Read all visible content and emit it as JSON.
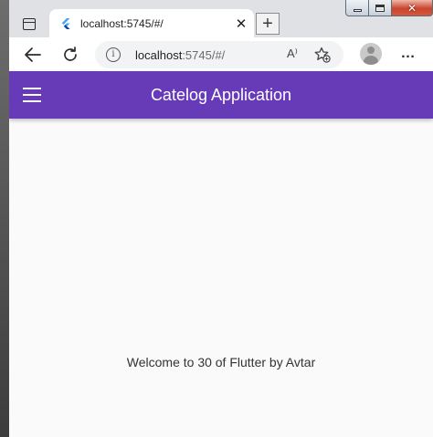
{
  "browser": {
    "tab": {
      "title": "localhost:5745/#/",
      "close_glyph": "✕"
    },
    "new_tab_glyph": "+",
    "caption": {
      "close_glyph": "✕"
    },
    "address_bar": {
      "host": "localhost",
      "rest": ":5745/#/",
      "info_glyph": "i",
      "read_aloud_glyph": "A⁾"
    },
    "more_glyph": "…"
  },
  "app": {
    "title": "Catelog Application",
    "welcome_text": "Welcome to 30 of Flutter by Avtar",
    "colors": {
      "appbar": "#673ab7",
      "background": "#fafafa"
    }
  }
}
